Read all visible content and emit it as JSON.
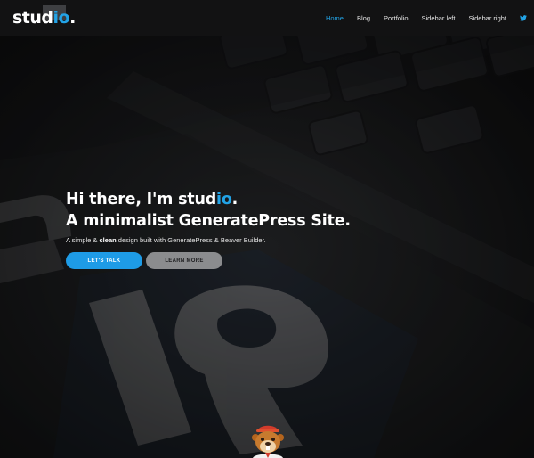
{
  "header": {
    "logo": {
      "main": "stud",
      "accent": "io",
      "dot": "."
    },
    "nav": [
      {
        "label": "Home",
        "active": true
      },
      {
        "label": "Blog",
        "active": false
      },
      {
        "label": "Portfolio",
        "active": false
      },
      {
        "label": "Sidebar left",
        "active": false
      },
      {
        "label": "Sidebar right",
        "active": false
      }
    ],
    "social_icon": "twitter-icon"
  },
  "hero": {
    "line1_pre": "Hi there, I'm stud",
    "line1_accent": "io",
    "line1_post": ".",
    "line2": "A minimalist GeneratePress Site.",
    "subtitle_pre": "A simple & ",
    "subtitle_bold": "clean",
    "subtitle_post": " design built with GeneratePress & Beaver Builder.",
    "primary_button": "LET'S TALK",
    "secondary_button": "LEARN MORE"
  },
  "colors": {
    "accent": "#22a3e6",
    "header_bg": "#121213",
    "button_primary": "#1e9be6",
    "button_secondary": "#8b8c8e"
  }
}
